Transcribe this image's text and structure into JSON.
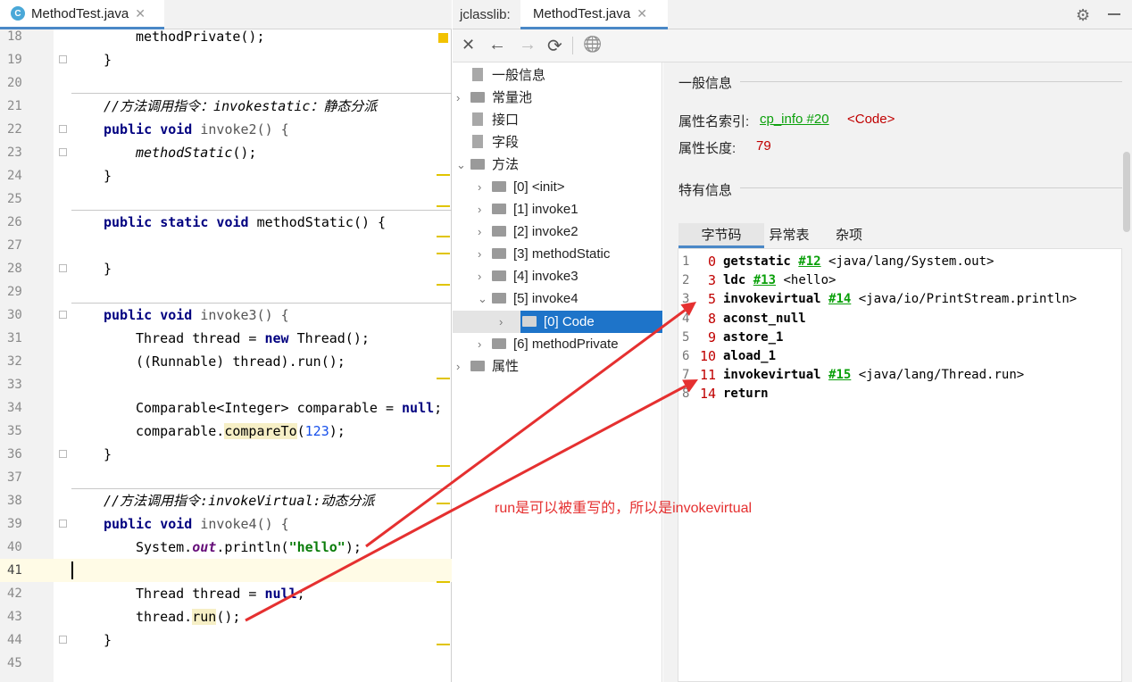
{
  "editor": {
    "tab_label": "MethodTest.java",
    "tab_icon": "C",
    "lines": [
      {
        "n": "18"
      },
      {
        "n": "19"
      },
      {
        "n": "20"
      },
      {
        "n": "21"
      },
      {
        "n": "22"
      },
      {
        "n": "23"
      },
      {
        "n": "24"
      },
      {
        "n": "25"
      },
      {
        "n": "26"
      },
      {
        "n": "27"
      },
      {
        "n": "28"
      },
      {
        "n": "29"
      },
      {
        "n": "30"
      },
      {
        "n": "31"
      },
      {
        "n": "32"
      },
      {
        "n": "33"
      },
      {
        "n": "34"
      },
      {
        "n": "35"
      },
      {
        "n": "36"
      },
      {
        "n": "37"
      },
      {
        "n": "38"
      },
      {
        "n": "39"
      },
      {
        "n": "40"
      },
      {
        "n": "41"
      },
      {
        "n": "42"
      },
      {
        "n": "43"
      },
      {
        "n": "44"
      },
      {
        "n": "45"
      }
    ],
    "code": {
      "l18": "methodPrivate();",
      "l19": "}",
      "l21_comment": "//方法调用指令：invokestatic：静态分派",
      "l22_kw": "public void",
      "l22_rest": " invoke2() {",
      "l23": "methodStatic",
      "l23_rest": "();",
      "l24": "}",
      "l26_kw": "public static void",
      "l26_rest": " methodStatic() {",
      "l28": "}",
      "l30_kw": "public void",
      "l30_rest": " invoke3() {",
      "l31_a": "Thread thread = ",
      "l31_kw": "new",
      "l31_b": " Thread();",
      "l32": "((Runnable) thread).run();",
      "l34_a": "Comparable<Integer> comparable = ",
      "l34_kw": "null",
      "l34_b": ";",
      "l35_a": "comparable.",
      "l35_hl": "compareTo",
      "l35_b": "(",
      "l35_num": "123",
      "l35_c": ");",
      "l36": "}",
      "l38_comment": "//方法调用指令:invokeVirtual:动态分派",
      "l39_kw": "public void",
      "l39_rest": " invoke4() {",
      "l40_a": "System.",
      "l40_fld": "out",
      "l40_b": ".println(",
      "l40_str": "\"hello\"",
      "l40_c": ");",
      "l42_a": "Thread thread = ",
      "l42_kw": "null",
      "l42_b": ";",
      "l43_a": "thread.",
      "l43_hl": "run",
      "l43_b": "();",
      "l44": "}"
    }
  },
  "jclasslib": {
    "title": "jclasslib:",
    "tab_label": "MethodTest.java",
    "toolbar": {
      "close": "✕",
      "back": "←",
      "forward": "→",
      "refresh": "⟳",
      "web": "🌐"
    },
    "tree": [
      {
        "label": "一般信息"
      },
      {
        "label": "常量池"
      },
      {
        "label": "接口"
      },
      {
        "label": "字段"
      },
      {
        "label": "方法"
      },
      {
        "label": "[0] <init>"
      },
      {
        "label": "[1] invoke1"
      },
      {
        "label": "[2] invoke2"
      },
      {
        "label": "[3] methodStatic"
      },
      {
        "label": "[4] invoke3"
      },
      {
        "label": "[5] invoke4"
      },
      {
        "label": "[0] Code"
      },
      {
        "label": "[6] methodPrivate"
      },
      {
        "label": "属性"
      }
    ],
    "details": {
      "general_heading": "一般信息",
      "name_index_label": "属性名索引:",
      "name_index_link": "cp_info #20",
      "name_index_value": "<Code>",
      "length_label": "属性长度:",
      "length_value": "79",
      "specific_heading": "特有信息",
      "tabs": [
        "字节码",
        "异常表",
        "杂项"
      ],
      "bytecode": [
        {
          "ln": "1",
          "off": "0",
          "ins": "getstatic",
          "ref": "#12",
          "arg": "<java/lang/System.out>"
        },
        {
          "ln": "2",
          "off": "3",
          "ins": "ldc",
          "ref": "#13",
          "arg": "<hello>"
        },
        {
          "ln": "3",
          "off": "5",
          "ins": "invokevirtual",
          "ref": "#14",
          "arg": "<java/io/PrintStream.println>"
        },
        {
          "ln": "4",
          "off": "8",
          "ins": "aconst_null",
          "ref": "",
          "arg": ""
        },
        {
          "ln": "5",
          "off": "9",
          "ins": "astore_1",
          "ref": "",
          "arg": ""
        },
        {
          "ln": "6",
          "off": "10",
          "ins": "aload_1",
          "ref": "",
          "arg": ""
        },
        {
          "ln": "7",
          "off": "11",
          "ins": "invokevirtual",
          "ref": "#15",
          "arg": "<java/lang/Thread.run>"
        },
        {
          "ln": "8",
          "off": "14",
          "ins": "return",
          "ref": "",
          "arg": ""
        }
      ]
    }
  },
  "annotation": "run是可以被重写的，所以是invokevirtual",
  "colors": {
    "arrow": "#e53030",
    "selection": "#1e74c9",
    "link": "#0aa00a",
    "offset": "#c00000"
  }
}
